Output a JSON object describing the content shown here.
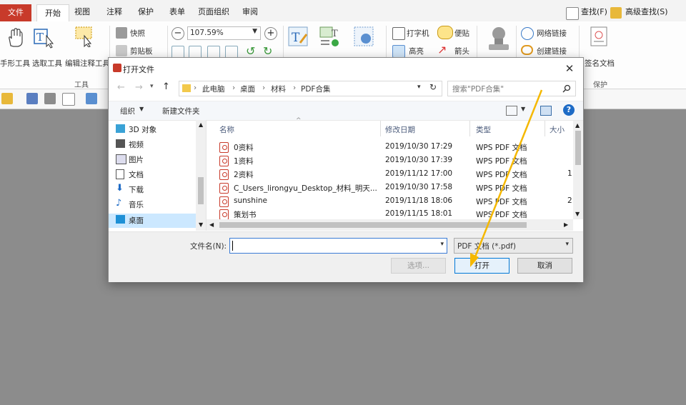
{
  "ribbon": {
    "tabs": [
      "文件",
      "开始",
      "视图",
      "注释",
      "保护",
      "表单",
      "页面组织",
      "审阅"
    ],
    "right": {
      "search": "查找(F)",
      "advanced_search": "高级查找(S)"
    },
    "tools": {
      "hand": "手形工具",
      "select": "选取工具",
      "edit_annot": "编辑注释工具",
      "snapshot": "快照",
      "clipboard": "剪贴板",
      "zoom": "107.59%",
      "typewriter": "打字机",
      "note": "便贴",
      "highlight": "高亮",
      "arrow": "箭头",
      "weblink": "网络链接",
      "create_link": "创建链接",
      "sign": "签名文档"
    },
    "groups": {
      "tools": "工具",
      "protect": "保护"
    }
  },
  "dialog": {
    "title": "打开文件",
    "breadcrumb": [
      "此电脑",
      "桌面",
      "材料",
      "PDF合集"
    ],
    "search_placeholder": "搜索\"PDF合集\"",
    "toolbar": {
      "organize": "组织",
      "new_folder": "新建文件夹"
    },
    "nav": [
      "3D 对象",
      "视频",
      "图片",
      "文档",
      "下载",
      "音乐",
      "桌面"
    ],
    "columns": {
      "name": "名称",
      "date": "修改日期",
      "type": "类型",
      "size": "大小"
    },
    "files": [
      {
        "name": "0资料",
        "date": "2019/10/30 17:29",
        "type": "WPS PDF 文档",
        "size": ""
      },
      {
        "name": "1资料",
        "date": "2019/10/30 17:39",
        "type": "WPS PDF 文档",
        "size": ""
      },
      {
        "name": "2资料",
        "date": "2019/11/12 17:00",
        "type": "WPS PDF 文档",
        "size": "1"
      },
      {
        "name": "C_Users_lirongyu_Desktop_材料_明天...",
        "date": "2019/10/30 17:58",
        "type": "WPS PDF 文档",
        "size": ""
      },
      {
        "name": "sunshine",
        "date": "2019/11/18 18:06",
        "type": "WPS PDF 文档",
        "size": "2"
      },
      {
        "name": "策划书",
        "date": "2019/11/15 18:01",
        "type": "WPS PDF 文档",
        "size": ""
      }
    ],
    "filename_label": "文件名(N):",
    "filename_value": "",
    "filetype": "PDF 文档 (*.pdf)",
    "buttons": {
      "options": "选项...",
      "open": "打开",
      "cancel": "取消"
    }
  },
  "colors": {
    "accent": "#c83a2a",
    "selected": "#cce8ff",
    "annotation": "#f5b800"
  }
}
